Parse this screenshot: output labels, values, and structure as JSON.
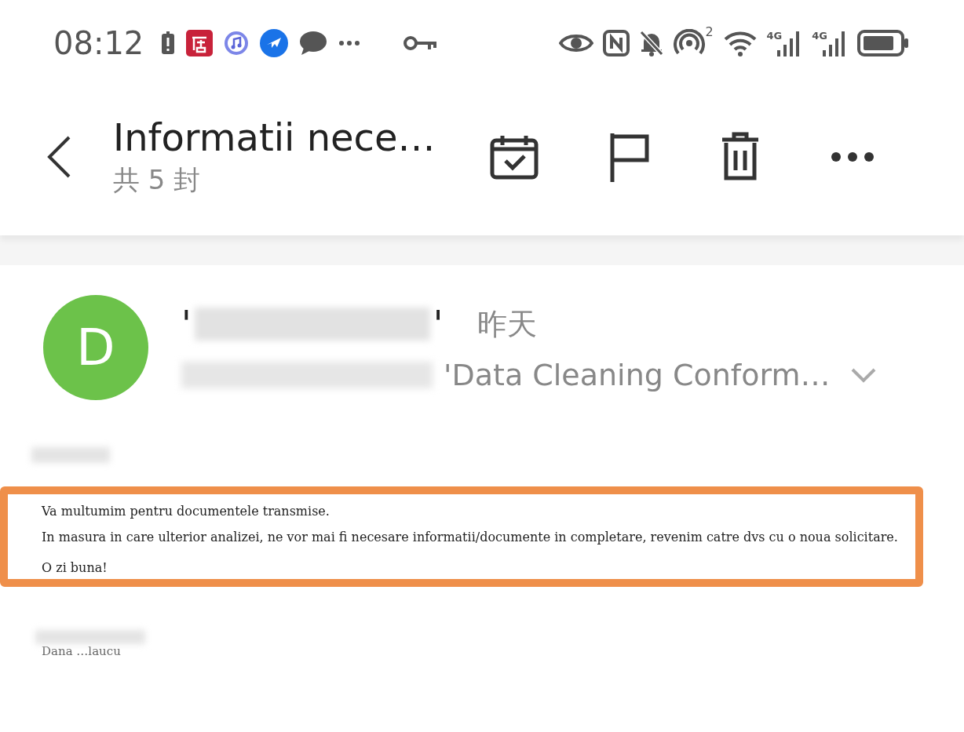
{
  "status_bar": {
    "time": "08:12",
    "hotspot_count": "2",
    "network_labels": [
      "4G",
      "4G"
    ]
  },
  "header": {
    "title": "Informatii nece…",
    "count": "共 5 封"
  },
  "message": {
    "avatar_letter": "D",
    "name_open": "'",
    "name_close": "'",
    "date": "昨天",
    "subject": "'Data Cleaning Conform…",
    "expanded": false
  },
  "body": {
    "highlighted": true,
    "paragraphs": [
      "Va multumim pentru documentele transmise.",
      "In masura in care ulterior analizei, ne vor mai fi necesare informatii/documente in completare, revenim catre dvs cu o noua solicitare."
    ],
    "closing": "O zi buna!",
    "signature": "Dana …laucu"
  }
}
